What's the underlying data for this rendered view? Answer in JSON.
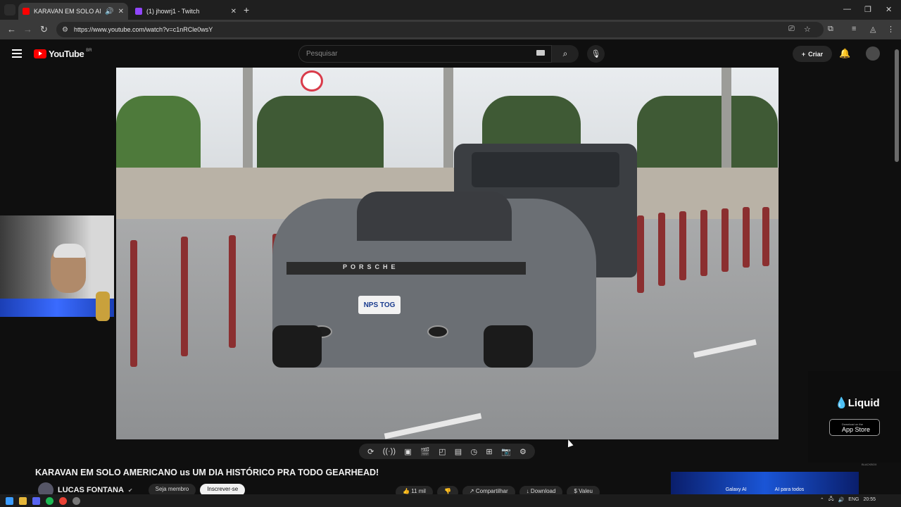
{
  "browser": {
    "tabs": [
      {
        "title": "KARAVAN EM SOLO AMERIC",
        "favicon_color": "#ff0000",
        "audio": "speaker-icon",
        "active": true
      },
      {
        "title": "(1) jhowrj1 - Twitch",
        "favicon_color": "#9146ff",
        "active": false
      }
    ],
    "url": "https://www.youtube.com/watch?v=c1nRCle0wsY"
  },
  "youtube": {
    "logo": "YouTube",
    "country": "BR",
    "search_placeholder": "Pesquisar",
    "create_label": "Criar"
  },
  "video": {
    "plate": "NPS TOG",
    "brand": "PORSCHE"
  },
  "ad": {
    "brand": "Liquid",
    "store_small": "Download on the",
    "store_label": "App Store",
    "watermark": "BLACKBOX"
  },
  "watch": {
    "title": "KARAVAN EM SOLO AMERICANO us UM DIA HISTÓRICO PRA TODO GEARHEAD!",
    "channel": "LUCAS FONTANA",
    "join_label": "Seja membro",
    "subscribe_label": "Inscrever-se",
    "likes": "11 mil",
    "share_label": "Compartilhar",
    "download_label": "Download",
    "thanks_label": "Valeu"
  },
  "promo": {
    "left": "Galaxy AI",
    "right": "AI para todos"
  },
  "taskbar": {
    "lang": "ENG",
    "time": "20:55"
  }
}
